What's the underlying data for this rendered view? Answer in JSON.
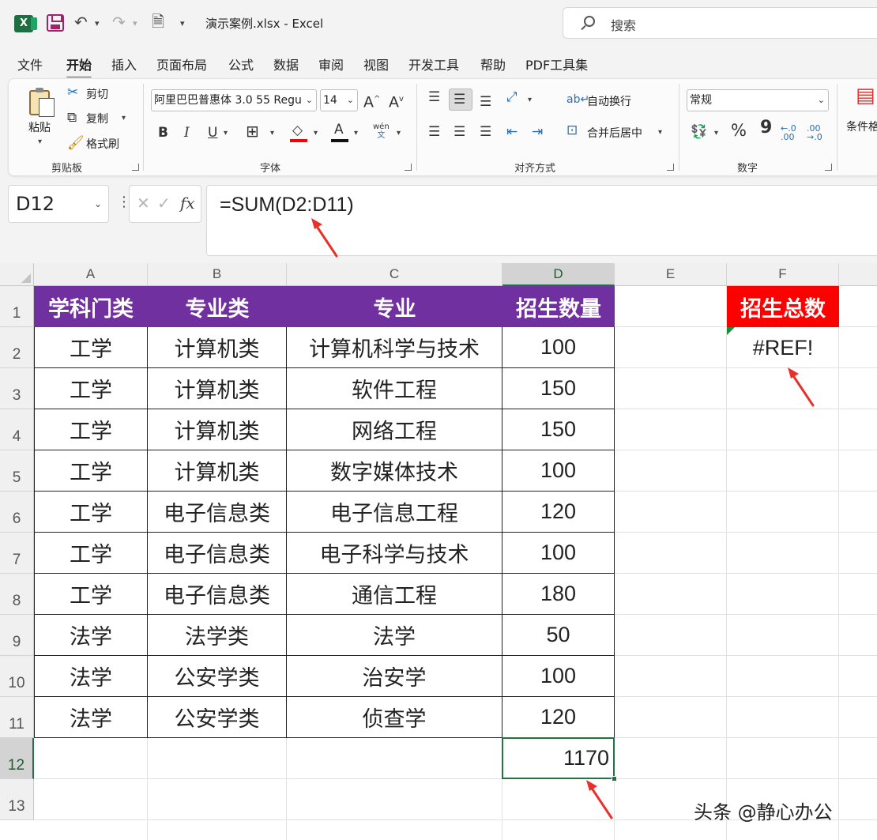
{
  "titlebar": {
    "document_title": "演示案例.xlsx  -  Excel",
    "search_placeholder": "搜索"
  },
  "menu": {
    "tabs": [
      "文件",
      "开始",
      "插入",
      "页面布局",
      "公式",
      "数据",
      "审阅",
      "视图",
      "开发工具",
      "帮助",
      "PDF工具集"
    ],
    "active": "开始"
  },
  "ribbon": {
    "clipboard": {
      "paste": "粘贴",
      "cut": "剪切",
      "copy": "复制",
      "format_painter": "格式刷",
      "label": "剪贴板"
    },
    "font": {
      "font_name": "阿里巴巴普惠体 3.0 55 Regu",
      "font_size": "14",
      "bold": "B",
      "italic": "I",
      "underline": "U",
      "grow": "A",
      "shrink": "A",
      "phonetic": "wén",
      "phonetic_sub": "文",
      "label": "字体"
    },
    "alignment": {
      "wrap_text": "自动换行",
      "merge_center": "合并后居中",
      "label": "对齐方式"
    },
    "number": {
      "format": "常规",
      "percent": "%",
      "comma": "9",
      "label": "数字"
    },
    "styles": {
      "conditional": "条件格"
    }
  },
  "formula_bar": {
    "name_box": "D12",
    "formula": "=SUM(D2:D11)",
    "fx": "fx",
    "cancel": "✕",
    "confirm": "✓"
  },
  "sheet": {
    "columns": [
      "A",
      "B",
      "C",
      "D",
      "E",
      "F"
    ],
    "selected_column": "D",
    "rows": [
      "1",
      "2",
      "3",
      "4",
      "5",
      "6",
      "7",
      "8",
      "9",
      "10",
      "11",
      "12",
      "13"
    ],
    "selected_row": "12",
    "header": [
      "学科门类",
      "专业类",
      "专业",
      "招生数量"
    ],
    "data": [
      [
        "工学",
        "计算机类",
        "计算机科学与技术",
        "100"
      ],
      [
        "工学",
        "计算机类",
        "软件工程",
        "150"
      ],
      [
        "工学",
        "计算机类",
        "网络工程",
        "150"
      ],
      [
        "工学",
        "计算机类",
        "数字媒体技术",
        "100"
      ],
      [
        "工学",
        "电子信息类",
        "电子信息工程",
        "120"
      ],
      [
        "工学",
        "电子信息类",
        "电子科学与技术",
        "100"
      ],
      [
        "工学",
        "电子信息类",
        "通信工程",
        "180"
      ],
      [
        "法学",
        "法学类",
        "法学",
        "50"
      ],
      [
        "法学",
        "公安学类",
        "治安学",
        "100"
      ],
      [
        "法学",
        "公安学类",
        "侦查学",
        "120"
      ]
    ],
    "total_header": "招生总数",
    "total_value": "#REF!",
    "sum_result": "1170",
    "colors": {
      "header_fill": "#7030a0",
      "total_fill": "#ff0000",
      "selection": "#217346",
      "arrow": "#e8312a"
    }
  },
  "watermark": "头条 @静心办公"
}
